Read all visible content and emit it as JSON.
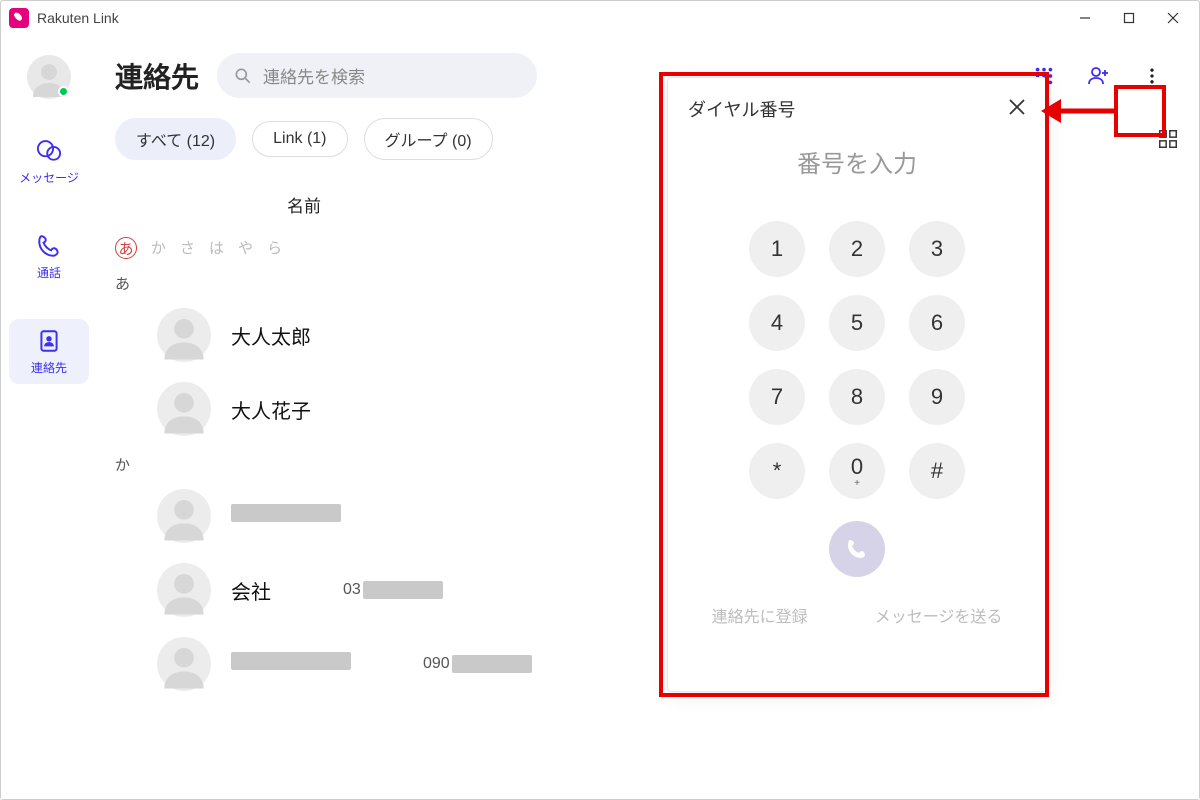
{
  "app": {
    "title": "Rakuten Link"
  },
  "nav": {
    "messages": "メッセージ",
    "calls": "通話",
    "contacts": "連絡先"
  },
  "header": {
    "title": "連絡先",
    "search_placeholder": "連絡先を検索"
  },
  "filters": {
    "all": "すべて (12)",
    "link": "Link (1)",
    "group": "グループ (0)"
  },
  "column_header": "名前",
  "kana": {
    "selected": "あ",
    "rest": [
      "か",
      "さ",
      "は",
      "や",
      "ら"
    ]
  },
  "sections": {
    "a": "あ",
    "ka": "か"
  },
  "contacts": {
    "c1": "大人太郎",
    "c2": "大人花子",
    "c4": "会社",
    "c4_sub": "03",
    "c5_sub": "090"
  },
  "dialog": {
    "title": "ダイヤル番号",
    "placeholder": "番号を入力",
    "keys": {
      "k1": "1",
      "k2": "2",
      "k3": "3",
      "k4": "4",
      "k5": "5",
      "k6": "6",
      "k7": "7",
      "k8": "8",
      "k9": "9",
      "ks": "*",
      "k0": "0",
      "k0s": "+",
      "kh": "#"
    },
    "add": "連絡先に登録",
    "send": "メッセージを送る"
  }
}
